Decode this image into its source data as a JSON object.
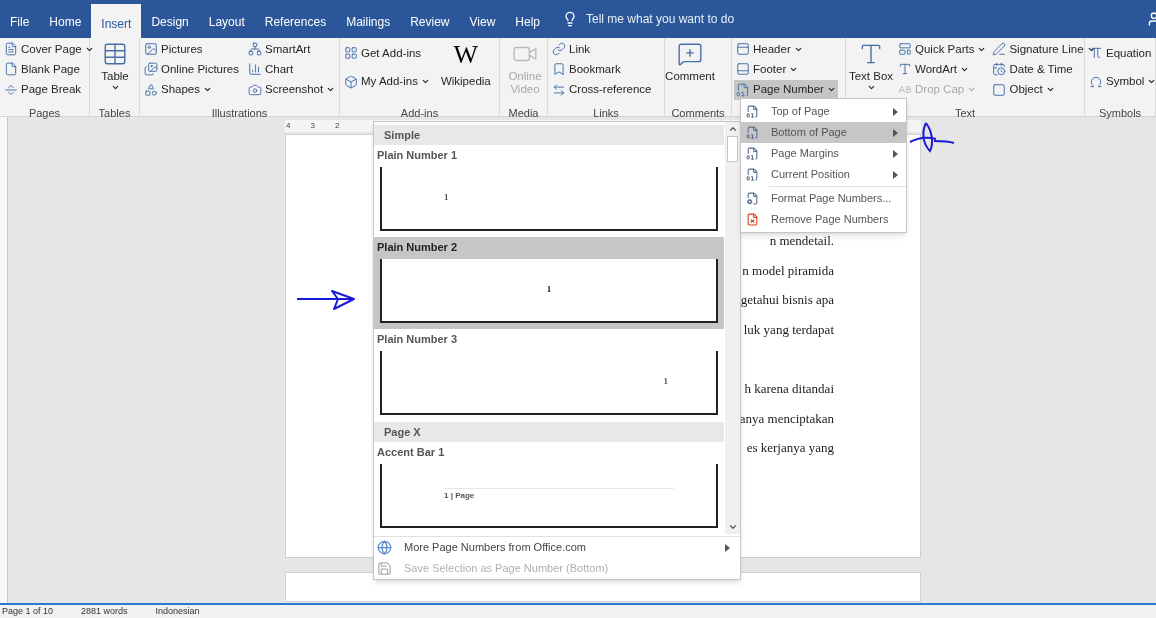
{
  "tabs": [
    {
      "label": "File",
      "selected": false
    },
    {
      "label": "Home",
      "selected": false
    },
    {
      "label": "Insert",
      "selected": true
    },
    {
      "label": "Design",
      "selected": false
    },
    {
      "label": "Layout",
      "selected": false
    },
    {
      "label": "References",
      "selected": false
    },
    {
      "label": "Mailings",
      "selected": false
    },
    {
      "label": "Review",
      "selected": false
    },
    {
      "label": "View",
      "selected": false
    },
    {
      "label": "Help",
      "selected": false
    }
  ],
  "tell_me": {
    "placeholder": "Tell me what you want to do"
  },
  "ribbon": {
    "groups": [
      {
        "label": "Pages",
        "columns": [
          [
            {
              "label": "Cover Page",
              "kind": "small",
              "menu": true,
              "disabled": false,
              "active": false
            },
            {
              "label": "Blank Page",
              "kind": "small",
              "menu": false,
              "disabled": false,
              "active": false
            },
            {
              "label": "Page Break",
              "kind": "small",
              "menu": false,
              "disabled": false,
              "active": false
            }
          ]
        ]
      },
      {
        "label": "Tables",
        "columns": [
          [
            {
              "label": "Table",
              "kind": "large",
              "menu": true,
              "disabled": false,
              "active": false
            }
          ]
        ]
      },
      {
        "label": "Illustrations",
        "columns": [
          [
            {
              "label": "Pictures",
              "kind": "small",
              "menu": false,
              "disabled": false,
              "active": false
            },
            {
              "label": "Online Pictures",
              "kind": "small",
              "menu": false,
              "disabled": false,
              "active": false
            },
            {
              "label": "Shapes",
              "kind": "small",
              "menu": true,
              "disabled": false,
              "active": false
            }
          ],
          [
            {
              "label": "SmartArt",
              "kind": "small",
              "menu": false,
              "disabled": false,
              "active": false
            },
            {
              "label": "Chart",
              "kind": "small",
              "menu": false,
              "disabled": false,
              "active": false
            },
            {
              "label": "Screenshot",
              "kind": "small",
              "menu": true,
              "disabled": false,
              "active": false
            }
          ]
        ]
      },
      {
        "label": "Add-ins",
        "columns": [
          [
            {
              "label": "Get Add-ins",
              "kind": "medium",
              "menu": false,
              "disabled": false,
              "active": false
            },
            {
              "label": "My Add-ins",
              "kind": "medium",
              "menu": true,
              "disabled": false,
              "active": false
            }
          ],
          [
            {
              "label": "Wikipedia",
              "kind": "logo",
              "glyph": "W",
              "menu": false,
              "disabled": false,
              "active": false
            }
          ]
        ]
      },
      {
        "label": "Media",
        "columns": [
          [
            {
              "label": "Online Video",
              "kind": "large",
              "menu": false,
              "disabled": true,
              "active": false
            }
          ]
        ]
      },
      {
        "label": "Links",
        "columns": [
          [
            {
              "label": "Link",
              "kind": "small",
              "menu": false,
              "disabled": false,
              "active": false
            },
            {
              "label": "Bookmark",
              "kind": "small",
              "menu": false,
              "disabled": false,
              "active": false
            },
            {
              "label": "Cross-reference",
              "kind": "small",
              "menu": false,
              "disabled": false,
              "active": false
            }
          ]
        ]
      },
      {
        "label": "Comments",
        "columns": [
          [
            {
              "label": "Comment",
              "kind": "large",
              "menu": false,
              "disabled": false,
              "active": false
            }
          ]
        ]
      },
      {
        "columns": [
          [
            {
              "label": "Header",
              "kind": "small",
              "menu": true,
              "disabled": false,
              "active": false
            },
            {
              "label": "Footer",
              "kind": "small",
              "menu": true,
              "disabled": false,
              "active": false
            },
            {
              "label": "Page Number",
              "kind": "small",
              "menu": true,
              "disabled": false,
              "active": true
            }
          ]
        ]
      },
      {
        "label": "Text",
        "columns": [
          [
            {
              "label": "Text Box",
              "kind": "large",
              "menu": true,
              "disabled": false,
              "active": false
            }
          ],
          [
            {
              "label": "Quick Parts",
              "kind": "small",
              "menu": true,
              "disabled": false,
              "active": false
            },
            {
              "label": "WordArt",
              "kind": "small",
              "menu": true,
              "disabled": false,
              "active": false
            },
            {
              "label": "Drop Cap",
              "kind": "small",
              "menu": true,
              "disabled": true,
              "active": false
            }
          ],
          [
            {
              "label": "Signature Line",
              "kind": "small",
              "menu": true,
              "disabled": false,
              "active": false
            },
            {
              "label": "Date & Time",
              "kind": "small",
              "menu": false,
              "disabled": false,
              "active": false
            },
            {
              "label": "Object",
              "kind": "small",
              "menu": true,
              "disabled": false,
              "active": false
            }
          ]
        ]
      },
      {
        "label": "Symbols",
        "columns": [
          [
            {
              "label": "Equation",
              "kind": "small",
              "disabled": false,
              "active": false
            },
            {
              "label": "Symbol",
              "kind": "small",
              "menu": true,
              "disabled": false,
              "active": false
            }
          ]
        ]
      }
    ]
  },
  "ruler": {
    "marks": [
      "4",
      "3",
      "2"
    ]
  },
  "document": {
    "paragraphs": [
      [
        "n mendetail.",
        "n model piramida",
        "getahui bisnis apa",
        "luk yang terdapat"
      ],
      [
        "h karena ditandai",
        "anya menciptakan",
        "es kerjanya yang"
      ]
    ]
  },
  "gallery": {
    "sections": [
      {
        "title": "Simple",
        "items": [
          {
            "label": "Plain Number 1",
            "selected": false,
            "kind": "left",
            "preview": "1"
          },
          {
            "label": "Plain Number 2",
            "selected": true,
            "kind": "center",
            "preview": "1"
          },
          {
            "label": "Plain Number 3",
            "selected": false,
            "kind": "right",
            "preview": "1"
          }
        ]
      },
      {
        "title": "Page X",
        "items": [
          {
            "label": "Accent Bar 1",
            "selected": false,
            "kind": "accent",
            "preview": "1 | Page"
          }
        ]
      }
    ],
    "footer": [
      {
        "label": "More Page Numbers from Office.com",
        "disabled": false,
        "submenu": true
      },
      {
        "label": "Save Selection as Page Number (Bottom)",
        "disabled": true,
        "submenu": false
      }
    ]
  },
  "submenu": {
    "items": [
      {
        "label": "Top of Page",
        "selected": false,
        "submenu": true
      },
      {
        "label": "Bottom of Page",
        "selected": true,
        "submenu": true
      },
      {
        "label": "Page Margins",
        "selected": false,
        "submenu": true
      },
      {
        "label": "Current Position",
        "selected": false,
        "submenu": true
      },
      {
        "label": "Format Page Numbers...",
        "selected": false,
        "submenu": false
      },
      {
        "label": "Remove Page Numbers",
        "selected": false,
        "submenu": false
      }
    ]
  },
  "status_bar": {
    "items": [
      "Page 1 of 10",
      "2881 words",
      "Indonesian"
    ]
  }
}
